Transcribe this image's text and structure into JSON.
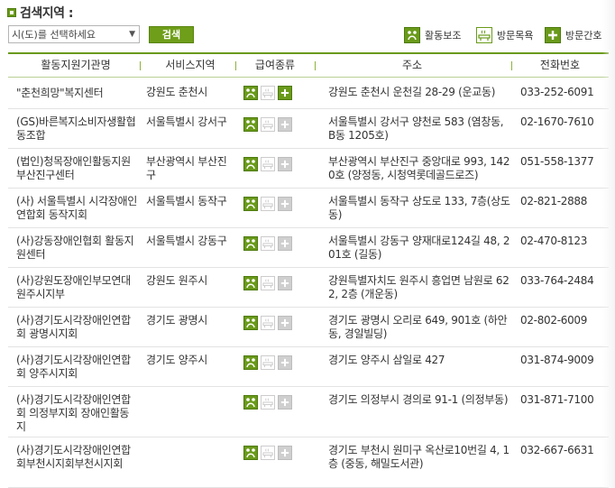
{
  "header": {
    "title": "검색지역 :"
  },
  "search": {
    "select_value": "시(도)를 선택하세요",
    "button_label": "검색"
  },
  "legend": {
    "care": "활동보조",
    "visit": "방문목욕",
    "nurse": "방문간호"
  },
  "table": {
    "columns": [
      "활동지원기관명",
      "서비스지역",
      "급여종류",
      "주소",
      "전화번호"
    ],
    "rows": [
      {
        "name": "\"춘천희망\"복지센터",
        "area": "강원도 춘천시",
        "types": [
          true,
          false,
          true
        ],
        "address": "강원도 춘천시 운천길 28-29 (운교동)",
        "phone": "033-252-6091"
      },
      {
        "name": "(GS)바른복지소비자생활협동조합",
        "area": "서울특별시 강서구",
        "types": [
          true,
          false,
          false
        ],
        "address": "서울특별시 강서구 양천로 583 (염창동, B동 1205호)",
        "phone": "02-1670-7610"
      },
      {
        "name": "(법인)청목장애인활동지원 부산진구센터",
        "area": "부산광역시 부산진구",
        "types": [
          true,
          false,
          false
        ],
        "address": "부산광역시 부산진구 중앙대로 993, 1420호 (양정동, 시청역롯데골드로즈)",
        "phone": "051-558-1377"
      },
      {
        "name": "(사) 서울특별시 시각장애인연합회 동작지회",
        "area": "서울특별시 동작구",
        "types": [
          true,
          false,
          false
        ],
        "address": "서울특별시 동작구 상도로 133, 7층(상도동)",
        "phone": "02-821-2888"
      },
      {
        "name": "(사)강동장애인협회 활동지원센터",
        "area": "서울특별시 강동구",
        "types": [
          true,
          false,
          false
        ],
        "address": "서울특별시 강동구 양재대로124길 48, 201호 (길동)",
        "phone": "02-470-8123"
      },
      {
        "name": "(사)강원도장애인부모연대 원주시지부",
        "area": "강원도 원주시",
        "types": [
          true,
          false,
          false
        ],
        "address": "강원특별자치도 원주시 흥업면 남원로 622, 2층 (개운동)",
        "phone": "033-764-2484"
      },
      {
        "name": "(사)경기도시각장애인연합회 광명시지회",
        "area": "경기도 광명시",
        "types": [
          true,
          false,
          false
        ],
        "address": "경기도 광명시 오리로 649, 901호 (하안동, 경일빌딩)",
        "phone": "02-802-6009"
      },
      {
        "name": "(사)경기도시각장애인연합회 양주시지회",
        "area": "경기도 양주시",
        "types": [
          true,
          false,
          false
        ],
        "address": "경기도 양주시 삼일로 427",
        "phone": "031-874-9009"
      },
      {
        "name": "(사)경기도시각장애인연합회 의정부지회 장애인활동지",
        "area": "",
        "types": [
          true,
          false,
          false
        ],
        "address": "경기도 의정부시 경의로 91-1 (의정부동)",
        "phone": "031-871-7100"
      },
      {
        "name": "(사)경기도시각장애인연합회부천시지회부천시지회",
        "area": "",
        "types": [
          true,
          false,
          false
        ],
        "address": "경기도 부천시 원미구 옥산로10번길 4, 1층 (중동, 해밀도서관)",
        "phone": "032-667-6631"
      }
    ]
  },
  "colors": {
    "accent": "#6a9a1a",
    "disabled": "#cfcfcf"
  },
  "icons": {
    "care": "wheelchair-care-icon",
    "visit": "bath-icon",
    "nurse": "plus-icon"
  }
}
